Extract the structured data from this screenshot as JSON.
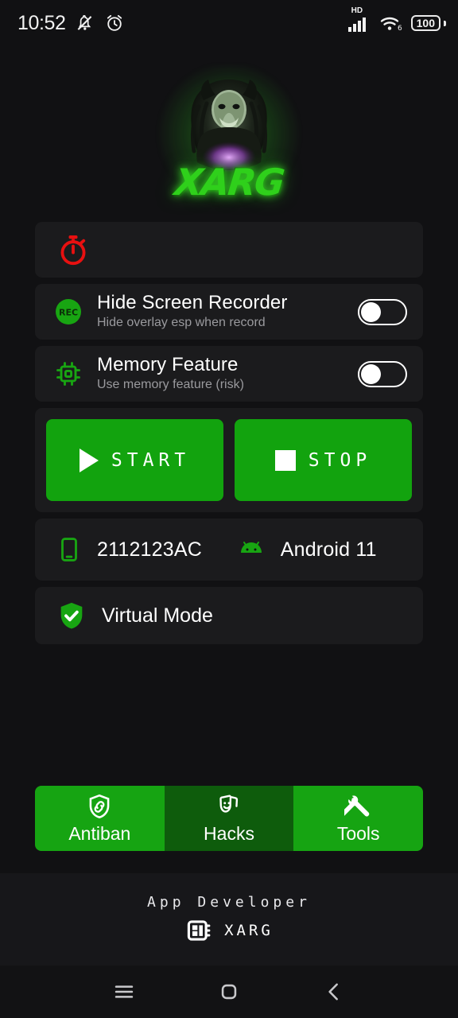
{
  "status_bar": {
    "time": "10:52",
    "silent_icon": "bell-muted-icon",
    "alarm_icon": "alarm-clock-icon",
    "network_label": "HD",
    "signal_icon": "signal-bars-icon",
    "wifi_icon": "wifi-6-icon",
    "battery_level": "100"
  },
  "logo": {
    "brand_text": "XARG",
    "icon": "xarg-predator-logo",
    "glow_color": "#2fd01b"
  },
  "timer_card": {
    "icon": "stopwatch-icon",
    "icon_color": "#e81010"
  },
  "toggles": [
    {
      "icon": "rec-record-icon",
      "icon_text": "REC",
      "title": "Hide Screen Recorder",
      "subtitle": "Hide overlay esp when record",
      "state": "off"
    },
    {
      "icon": "memory-chip-icon",
      "title": "Memory Feature",
      "subtitle": "Use memory feature (risk)",
      "state": "off"
    }
  ],
  "actions": {
    "start_label": "START",
    "start_icon": "play-triangle-icon",
    "stop_label": "STOP",
    "stop_icon": "stop-square-icon",
    "button_color": "#12a30e"
  },
  "device": {
    "phone_icon": "smartphone-icon",
    "model": "2112123AC",
    "android_icon": "android-robot-icon",
    "os_version": "Android 11"
  },
  "virtual_mode": {
    "icon": "shield-check-icon",
    "label": "Virtual Mode"
  },
  "tabs": [
    {
      "label": "Antiban",
      "icon": "shield-link-icon",
      "active": true
    },
    {
      "label": "Hacks",
      "icon": "theater-masks-icon",
      "active": false
    },
    {
      "label": "Tools",
      "icon": "wrench-screwdriver-icon",
      "active": true
    }
  ],
  "footer": {
    "title": "App Developer",
    "developer_icon": "chip-dashboard-icon",
    "developer_name": "XARG"
  },
  "nav_bar": {
    "recents": "menu-hamburger-icon",
    "home": "home-square-icon",
    "back": "back-chevron-icon"
  },
  "colors": {
    "background": "#111113",
    "card": "#1b1b1d",
    "accent_green": "#16a412",
    "inactive_green": "#0e5c0c",
    "red": "#e81010"
  }
}
